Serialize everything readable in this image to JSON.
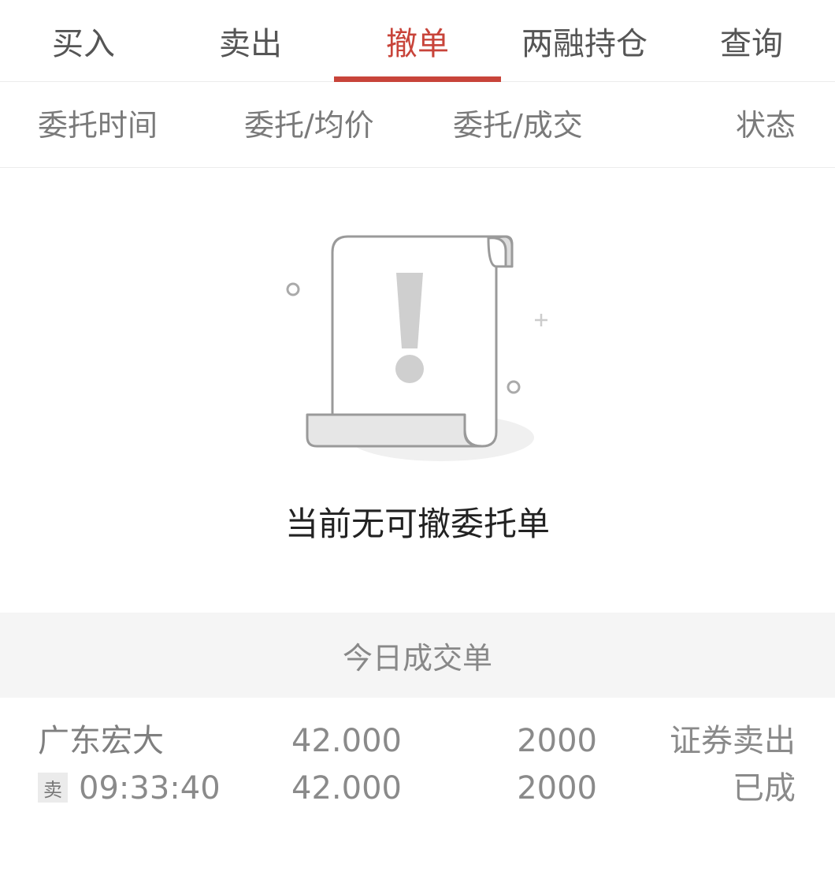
{
  "tabs": [
    {
      "label": "买入"
    },
    {
      "label": "卖出"
    },
    {
      "label": "撤单"
    },
    {
      "label": "两融持仓"
    },
    {
      "label": "查询"
    }
  ],
  "active_tab": "撤单",
  "columns": {
    "time": "委托时间",
    "price": "委托/均价",
    "qty": "委托/成交",
    "status": "状态"
  },
  "empty_state": {
    "message": "当前无可撤委托单",
    "icon": "document-warning-icon"
  },
  "today_trades": {
    "title": "今日成交单",
    "rows": [
      {
        "name": "广东宏大",
        "side_badge": "卖",
        "time": "09:33:40",
        "order_price": "42.000",
        "avg_price": "42.000",
        "order_qty": "2000",
        "filled_qty": "2000",
        "type": "证券卖出",
        "status": "已成"
      }
    ]
  },
  "colors": {
    "accent": "#c8443a",
    "text_muted": "#8a8a8a",
    "section_bg": "#f5f5f5"
  }
}
